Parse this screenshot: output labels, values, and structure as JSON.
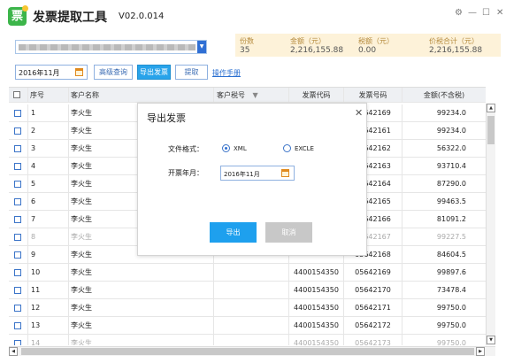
{
  "app": {
    "name": "发票提取工具",
    "version": "V02.0.014",
    "window_controls": [
      "⚙",
      "—",
      "☐",
      "✕"
    ]
  },
  "account_select": {
    "value": ""
  },
  "stats": [
    {
      "label": "份数",
      "value": "35"
    },
    {
      "label": "金额（元）",
      "value": "2,216,155.88"
    },
    {
      "label": "税额（元）",
      "value": "0.00"
    },
    {
      "label": "价税合计（元）",
      "value": "2,216,155.88"
    }
  ],
  "toolbar": {
    "date_value": "2016年11月",
    "advanced_search": "高级查询",
    "export_invoice": "导出发票",
    "extract": "提取",
    "manual_link": "操作手册"
  },
  "table": {
    "headers": [
      "序号",
      "客户名称",
      "客户税号",
      "发票代码",
      "发票号码",
      "金额(不含税)"
    ],
    "sort_icon": "▼",
    "rows": [
      {
        "seq": "1",
        "customer": "李火生",
        "tax_no": "",
        "code": "",
        "number": "05642169",
        "amount": "99234.0",
        "dim": false
      },
      {
        "seq": "2",
        "customer": "李火生",
        "tax_no": "",
        "code": "",
        "number": "05642161",
        "amount": "99234.0",
        "dim": false
      },
      {
        "seq": "3",
        "customer": "李火生",
        "tax_no": "",
        "code": "",
        "number": "05642162",
        "amount": "56322.0",
        "dim": false
      },
      {
        "seq": "4",
        "customer": "李火生",
        "tax_no": "",
        "code": "",
        "number": "05642163",
        "amount": "93710.4",
        "dim": false
      },
      {
        "seq": "5",
        "customer": "李火生",
        "tax_no": "",
        "code": "",
        "number": "05642164",
        "amount": "87290.0",
        "dim": false
      },
      {
        "seq": "6",
        "customer": "李火生",
        "tax_no": "",
        "code": "",
        "number": "05642165",
        "amount": "99463.5",
        "dim": false
      },
      {
        "seq": "7",
        "customer": "李火生",
        "tax_no": "",
        "code": "",
        "number": "05642166",
        "amount": "81091.2",
        "dim": false
      },
      {
        "seq": "8",
        "customer": "李火生",
        "tax_no": "",
        "code": "",
        "number": "05642167",
        "amount": "99227.5",
        "dim": true
      },
      {
        "seq": "9",
        "customer": "李火生",
        "tax_no": "",
        "code": "",
        "number": "05642168",
        "amount": "84604.5",
        "dim": false
      },
      {
        "seq": "10",
        "customer": "李火生",
        "tax_no": "",
        "code": "4400154350",
        "number": "05642169",
        "amount": "99897.6",
        "dim": false
      },
      {
        "seq": "11",
        "customer": "李火生",
        "tax_no": "",
        "code": "4400154350",
        "number": "05642170",
        "amount": "73478.4",
        "dim": false
      },
      {
        "seq": "12",
        "customer": "李火生",
        "tax_no": "",
        "code": "4400154350",
        "number": "05642171",
        "amount": "99750.0",
        "dim": false
      },
      {
        "seq": "13",
        "customer": "李火生",
        "tax_no": "",
        "code": "4400154350",
        "number": "05642172",
        "amount": "99750.0",
        "dim": false
      },
      {
        "seq": "14",
        "customer": "李火生",
        "tax_no": "",
        "code": "4400154350",
        "number": "05642173",
        "amount": "99750.0",
        "dim": true
      }
    ]
  },
  "dialog": {
    "title": "导出发票",
    "close": "✕",
    "format_label": "文件格式：",
    "format_options": [
      "XML",
      "EXCLE"
    ],
    "selected_format": "XML",
    "date_label": "开票年月：",
    "date_value": "2016年11月",
    "export_button": "导出",
    "cancel_button": "取消"
  },
  "colors": {
    "primary": "#1ea0ee",
    "stat_bar": "#fdf2d9",
    "logo": "#3cb54a"
  }
}
